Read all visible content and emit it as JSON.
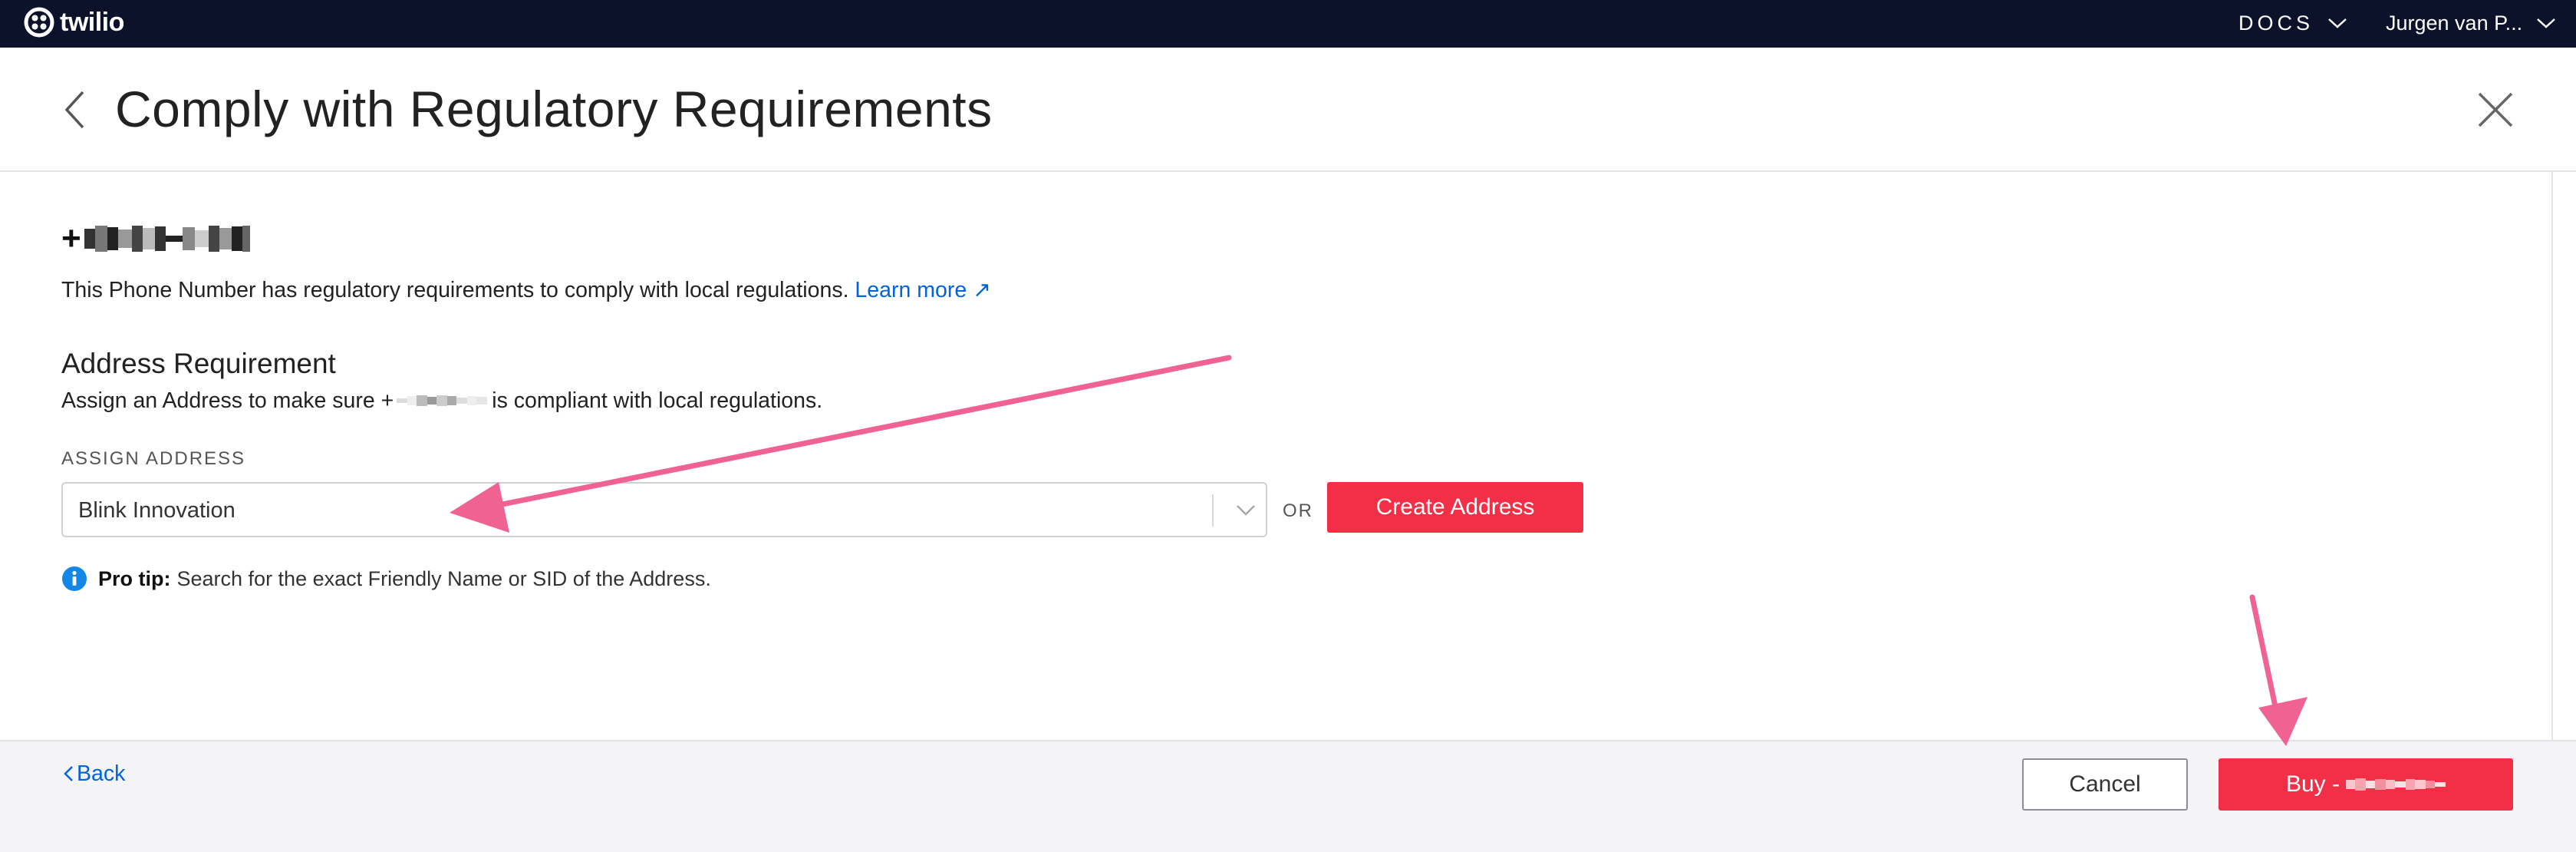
{
  "topnav": {
    "brand": "twilio",
    "docs_label": "DOCS",
    "user_label": "Jurgen van P..."
  },
  "header": {
    "title": "Comply with Regulatory Requirements"
  },
  "content": {
    "phone_prefix": "+",
    "regulatory_text": "This Phone Number has regulatory requirements to comply with local regulations.",
    "learn_more": "Learn more ↗",
    "section_title": "Address Requirement",
    "assign_text_before": "Assign an Address to make sure +",
    "assign_text_after": "is compliant with local regulations.",
    "assign_label": "ASSIGN ADDRESS",
    "selected_address": "Blink Innovation",
    "or_label": "OR",
    "create_address_button": "Create Address",
    "protip_label": "Pro tip:",
    "protip_text": "Search for the exact Friendly Name or SID of the Address."
  },
  "footer": {
    "back_label": "Back",
    "cancel_button": "Cancel",
    "buy_button_prefix": "Buy -"
  },
  "icons": {
    "logo": "twilio-logo-icon",
    "header_back": "chevron-left-icon",
    "close": "close-icon",
    "dropdown": "chevron-down-icon",
    "info": "info-icon"
  },
  "colors": {
    "nav_bg": "#0d122b",
    "brand_red": "#f22f46",
    "link_blue": "#0263e0",
    "annotation_pink": "#f06292"
  }
}
